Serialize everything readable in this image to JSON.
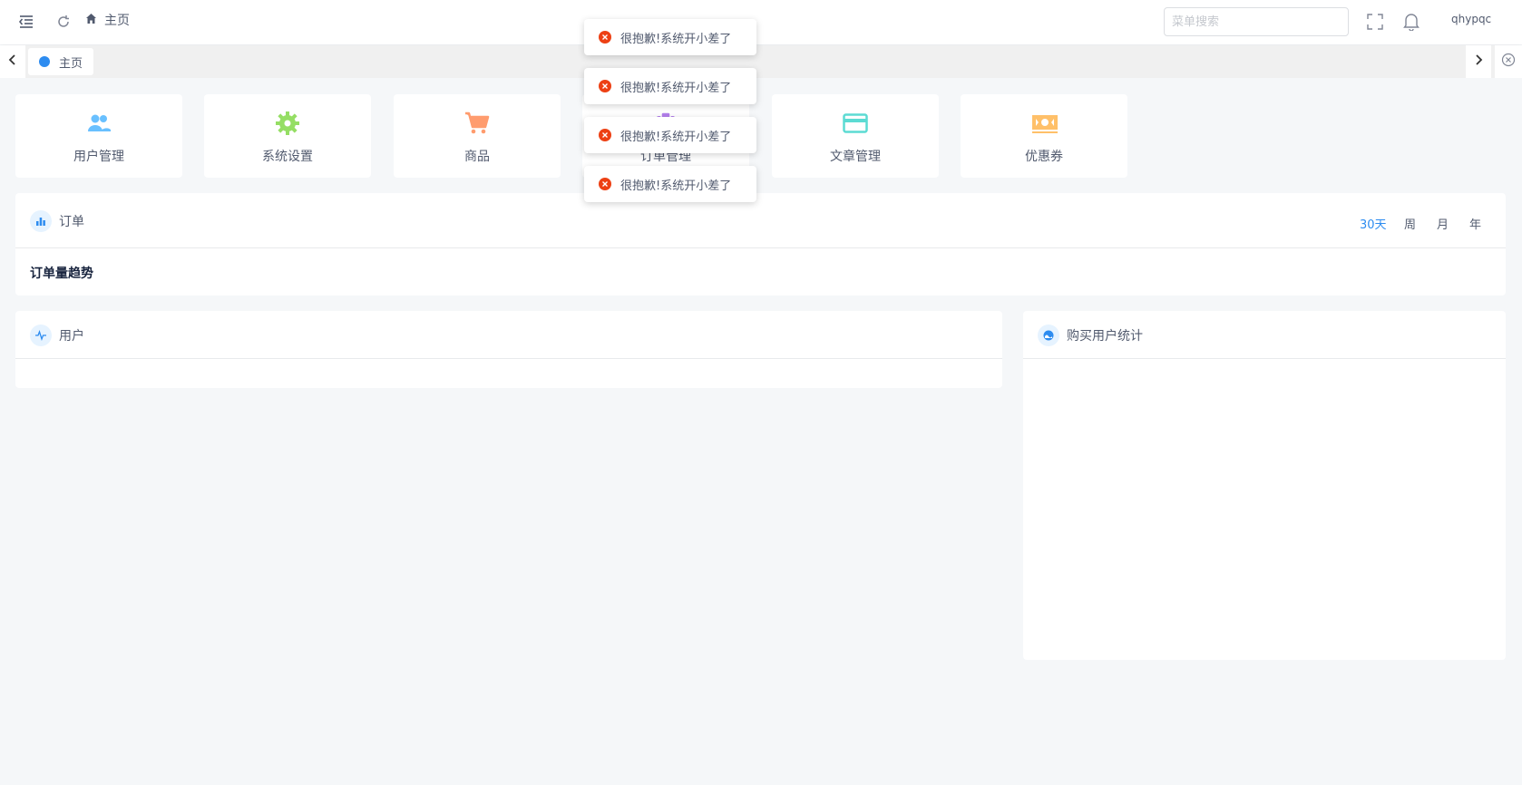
{
  "header": {
    "breadcrumb": "主页",
    "search_placeholder": "菜单搜索",
    "username": "qhypqc",
    "icons": [
      "menu-fold-icon",
      "refresh-icon",
      "home-icon",
      "fullscreen-icon",
      "bell-icon"
    ]
  },
  "tabs": [
    {
      "label": "主页",
      "active": true
    }
  ],
  "quick_entries": [
    {
      "label": "用户管理",
      "icon": "users-icon",
      "color": "#69c0ff"
    },
    {
      "label": "系统设置",
      "icon": "gear-icon",
      "color": "#95de64"
    },
    {
      "label": "商品",
      "icon": "cart-icon",
      "color": "#ff9c6e"
    },
    {
      "label": "订单管理",
      "icon": "order-icon",
      "color": "#b37feb"
    },
    {
      "label": "文章管理",
      "icon": "card-icon",
      "color": "#5cdbd3"
    },
    {
      "label": "优惠券",
      "icon": "coupon-icon",
      "color": "#ffc069"
    }
  ],
  "orders": {
    "title": "订单",
    "ranges": [
      "30天",
      "周",
      "月",
      "年"
    ],
    "active_range": "30天",
    "subtitle": "订单量趋势"
  },
  "users": {
    "title": "用户"
  },
  "buyers": {
    "title": "购买用户统计"
  },
  "toasts": [
    "很抱歉!系统开小差了",
    "很抱歉!系统开小差了",
    "很抱歉!系统开小差了",
    "很抱歉!系统开小差了"
  ],
  "colors": {
    "accent": "#2d8cf0",
    "error": "#ed4014",
    "background": "#f5f7f9"
  }
}
